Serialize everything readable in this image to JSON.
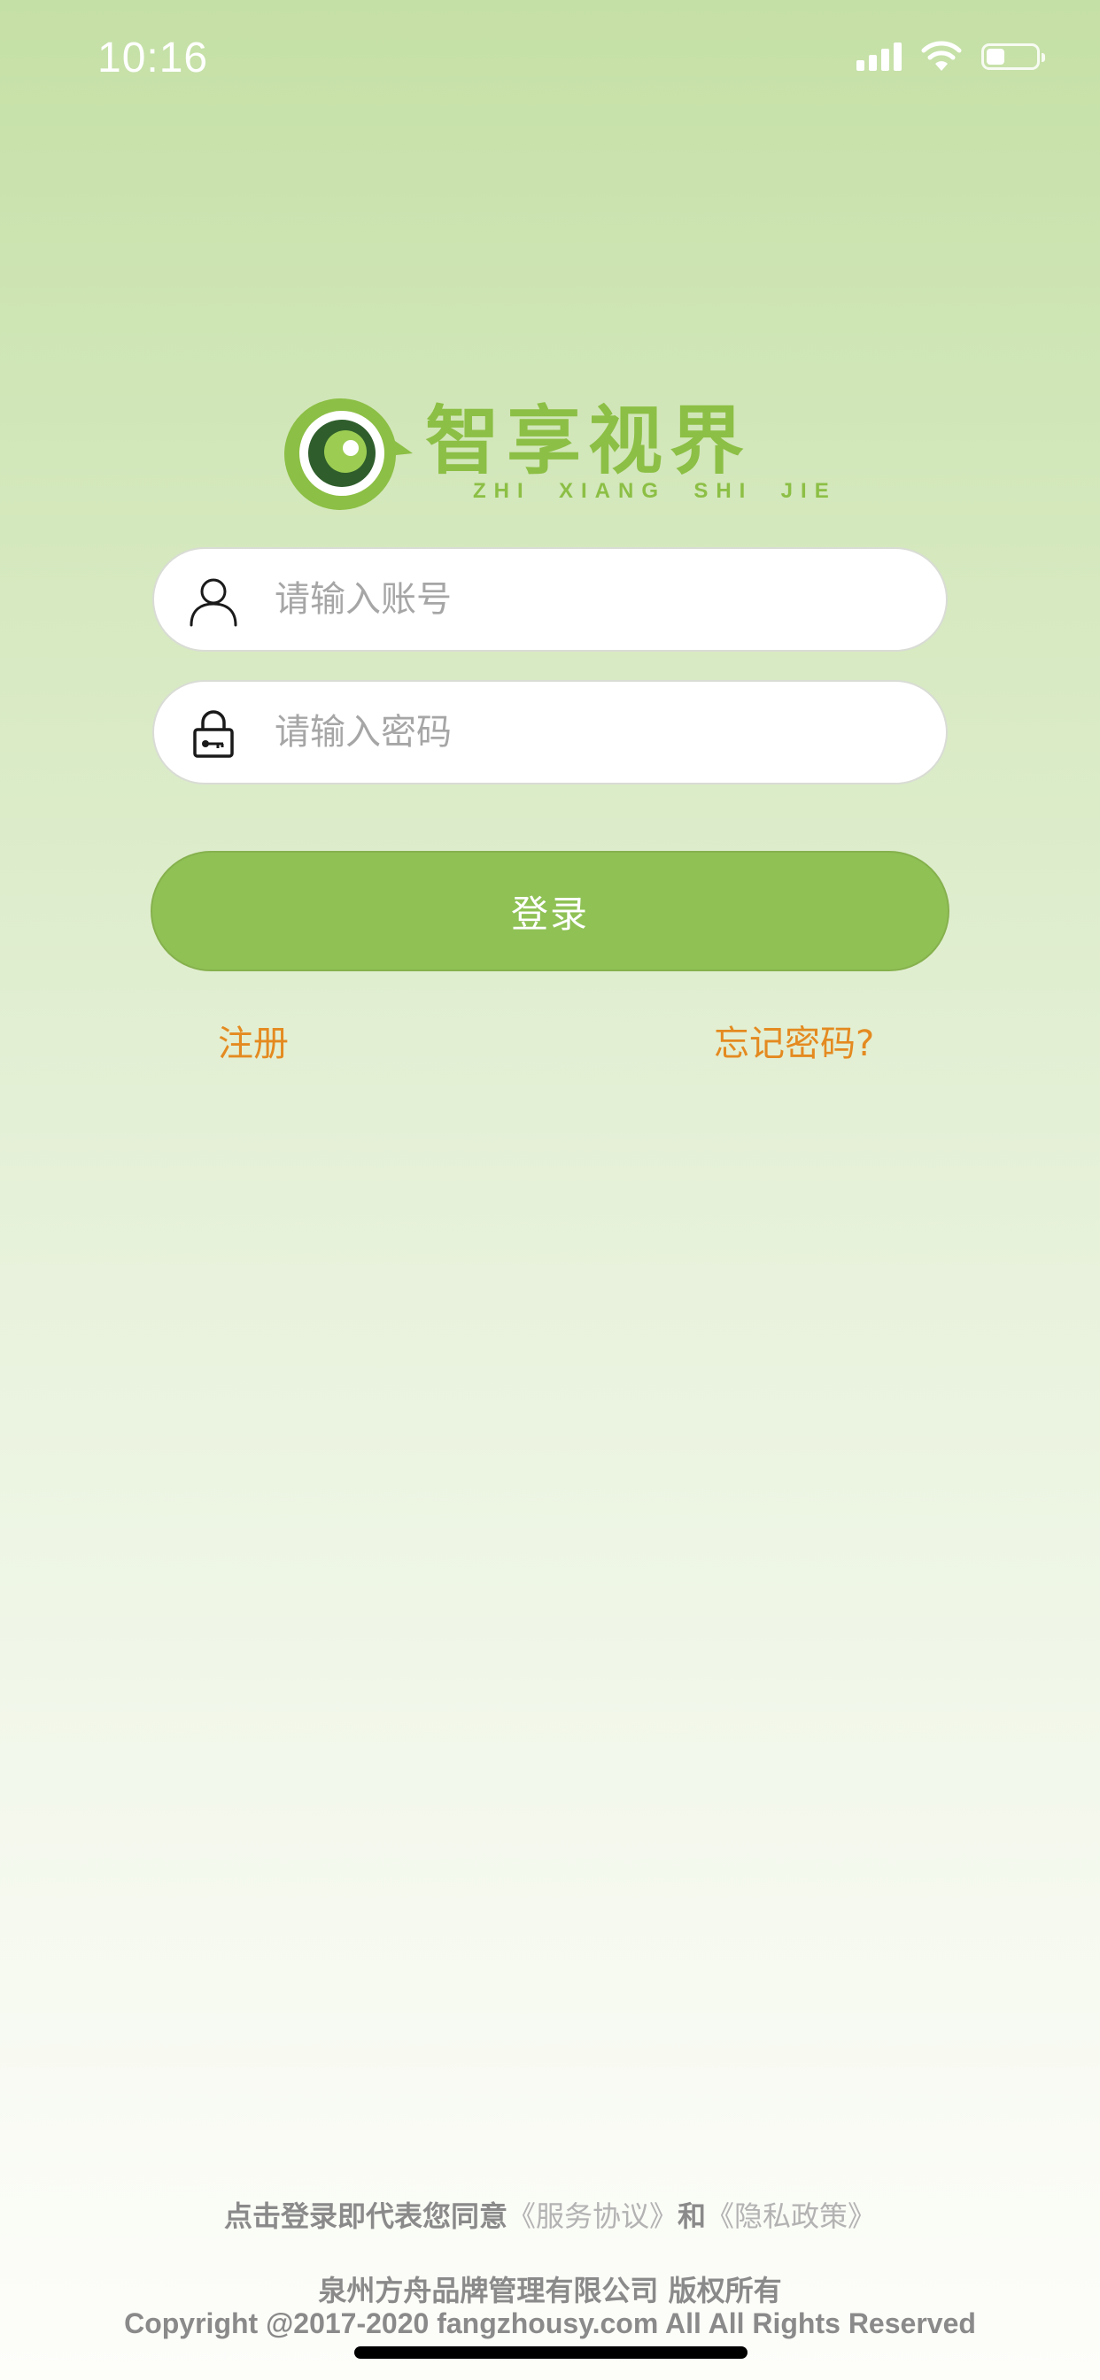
{
  "status_bar": {
    "time": "10:16",
    "icons": [
      "signal-icon",
      "wifi-icon",
      "battery-icon"
    ]
  },
  "logo": {
    "title": "智享视界",
    "pinyin": "ZHI  XIANG  SHI  JIE",
    "colors": {
      "brand_green": "#8cbf45",
      "dark_green": "#2f5e2c"
    }
  },
  "form": {
    "account_placeholder": "请输入账号",
    "account_value": "",
    "account_icon": "user-icon",
    "password_placeholder": "请输入密码",
    "password_value": "",
    "password_icon": "lock-icon",
    "login_label": "登录",
    "register_label": "注册",
    "forgot_label": "忘记密码?"
  },
  "footer": {
    "agreement_prefix": "点击登录即代表您同意",
    "service_agreement": "《服务协议》",
    "and": "和",
    "privacy_policy": "《隐私政策》",
    "company": "泉州方舟品牌管理有限公司 版权所有",
    "copyright": "Copyright @2017-2020 fangzhousy.com All All Rights Reserved"
  },
  "colors": {
    "accent_green": "#8fc155",
    "link_orange": "#e48a20",
    "footer_gray": "#8a8a8a"
  }
}
